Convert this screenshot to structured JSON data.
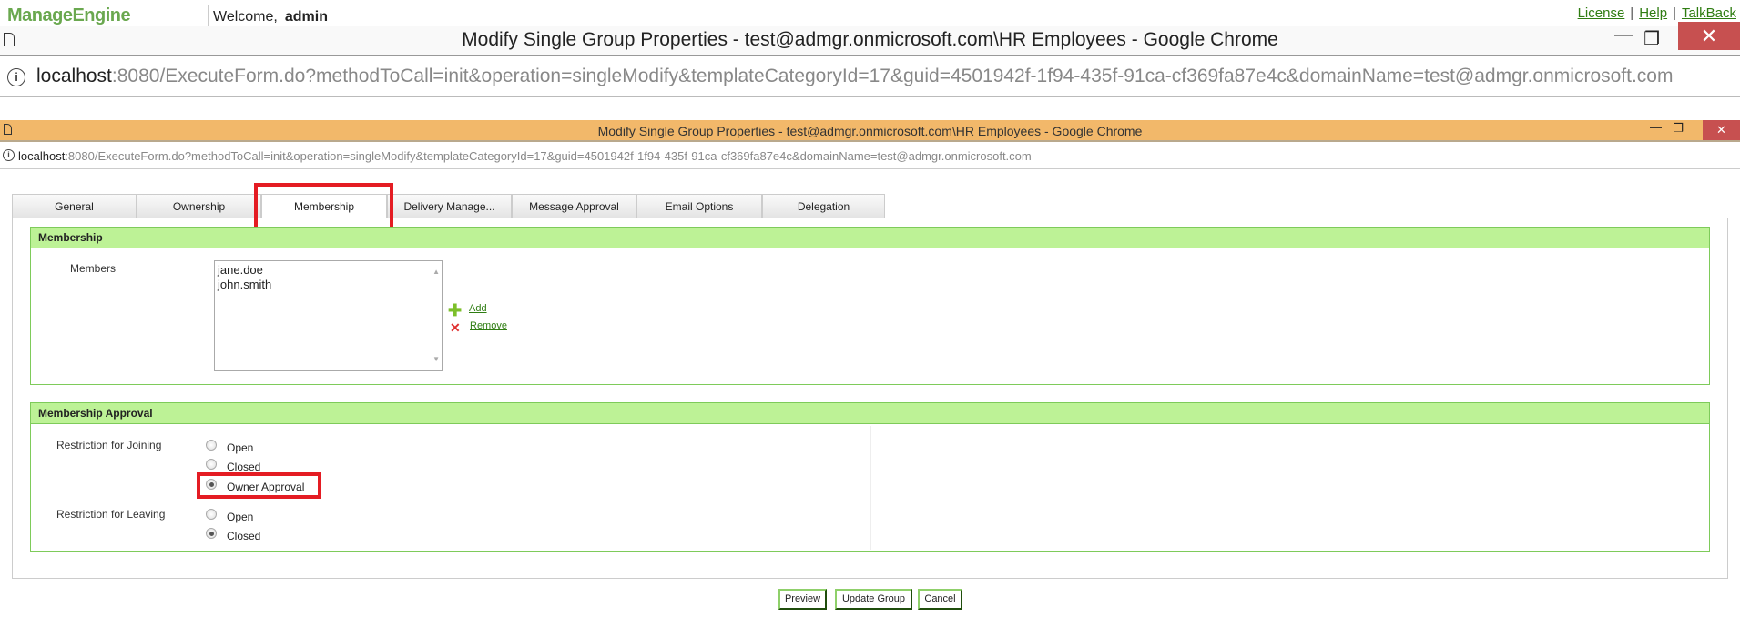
{
  "app_header": {
    "logo": "ManageEngine",
    "welcome": "Welcome,",
    "user": "admin",
    "links": [
      "License",
      "Help",
      "TalkBack"
    ],
    "link_separator": "|"
  },
  "outer_window": {
    "title": "Modify Single Group Properties - test@admgr.onmicrosoft.com\\HR Employees - Google Chrome",
    "url_host": "localhost",
    "url_rest": ":8080/ExecuteForm.do?methodToCall=init&operation=singleModify&templateCategoryId=17&guid=4501942f-1f94-435f-91ca-cf369fa87e4c&domainName=test@admgr.onmicrosoft.com"
  },
  "inner_window": {
    "title": "Modify Single Group Properties - test@admgr.onmicrosoft.com\\HR Employees - Google Chrome",
    "url_host": "localhost",
    "url_rest": ":8080/ExecuteForm.do?methodToCall=init&operation=singleModify&templateCategoryId=17&guid=4501942f-1f94-435f-91ca-cf369fa87e4c&domainName=test@admgr.onmicrosoft.com",
    "accent_color": "#f2b86a"
  },
  "tabs": [
    "General",
    "Ownership",
    "Membership",
    "Delivery Manage...",
    "Message Approval",
    "Email Options",
    "Delegation"
  ],
  "active_tab": "Membership",
  "membership": {
    "header": "Membership",
    "members_label": "Members",
    "members": [
      "jane.doe",
      "john.smith"
    ],
    "add_label": "Add",
    "remove_label": "Remove"
  },
  "approval": {
    "header": "Membership Approval",
    "joining_label": "Restriction for Joining",
    "joining_options": [
      "Open",
      "Closed",
      "Owner Approval"
    ],
    "joining_selected": "Owner Approval",
    "leaving_label": "Restriction for Leaving",
    "leaving_options": [
      "Open",
      "Closed"
    ],
    "leaving_selected": "Closed"
  },
  "buttons": {
    "preview": "Preview",
    "update": "Update Group",
    "cancel": "Cancel"
  },
  "colors": {
    "section_header": "#bdf296",
    "highlight": "#e41c23",
    "link": "#2f7d12"
  }
}
